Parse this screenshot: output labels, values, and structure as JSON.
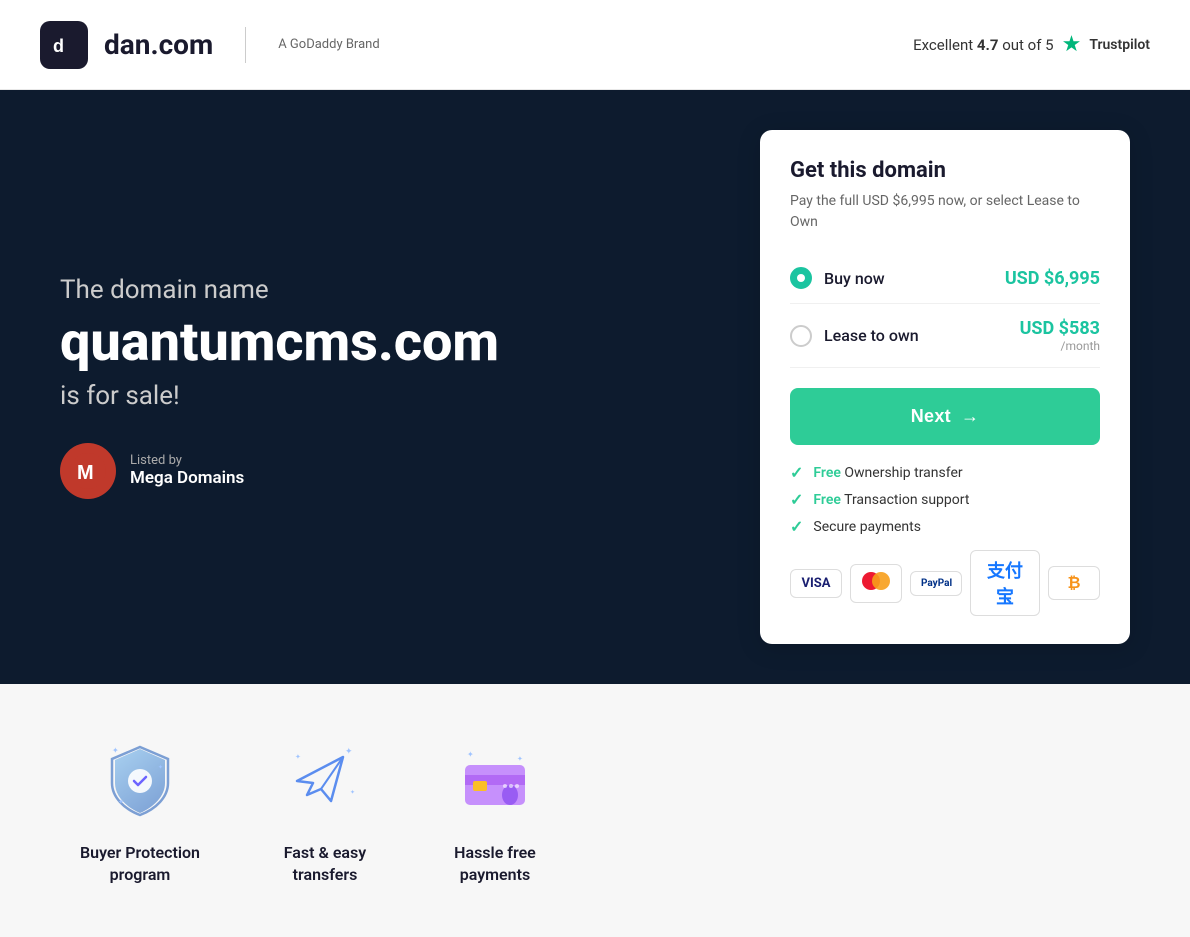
{
  "header": {
    "logo_text": "dan.com",
    "godaddy_label": "A GoDaddy Brand",
    "trustpilot_prefix": "Excellent",
    "trustpilot_score": "4.7",
    "trustpilot_suffix": "out of 5",
    "trustpilot_brand": "Trustpilot"
  },
  "hero": {
    "subtitle": "The domain name",
    "domain": "quantumcms.com",
    "forsale": "is for sale!",
    "listed_label": "Listed by",
    "listed_name": "Mega Domains"
  },
  "card": {
    "title": "Get this domain",
    "subtitle": "Pay the full USD $6,995 now, or select Lease to Own",
    "buy_now_label": "Buy now",
    "buy_now_price": "USD $6,995",
    "lease_label": "Lease to own",
    "lease_price": "USD $583",
    "lease_period": "/month",
    "next_label": "Next",
    "benefit1_free": "Free",
    "benefit1_text": "Ownership transfer",
    "benefit2_free": "Free",
    "benefit2_text": "Transaction support",
    "benefit3_text": "Secure payments"
  },
  "features": [
    {
      "icon": "shield",
      "title": "Buyer Protection\nprogram"
    },
    {
      "icon": "plane",
      "title": "Fast & easy\ntransfers"
    },
    {
      "icon": "creditcard",
      "title": "Hassle free\npayments"
    }
  ]
}
